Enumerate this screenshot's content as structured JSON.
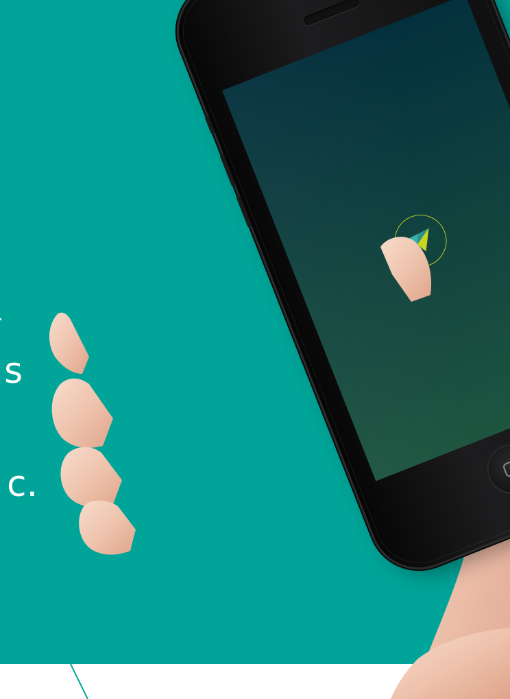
{
  "background_color": "#00a498",
  "partial_text": [
    {
      "text": "r"
    },
    {
      "text": "s"
    },
    {
      "text": "c."
    }
  ],
  "phone": {
    "screen_gradient": [
      "#03303d",
      "#1d5540"
    ],
    "logo_ring_color": "#b6c82c",
    "logo_icon": "triangle-logo-icon",
    "home_button_icon": "home-square-icon"
  }
}
